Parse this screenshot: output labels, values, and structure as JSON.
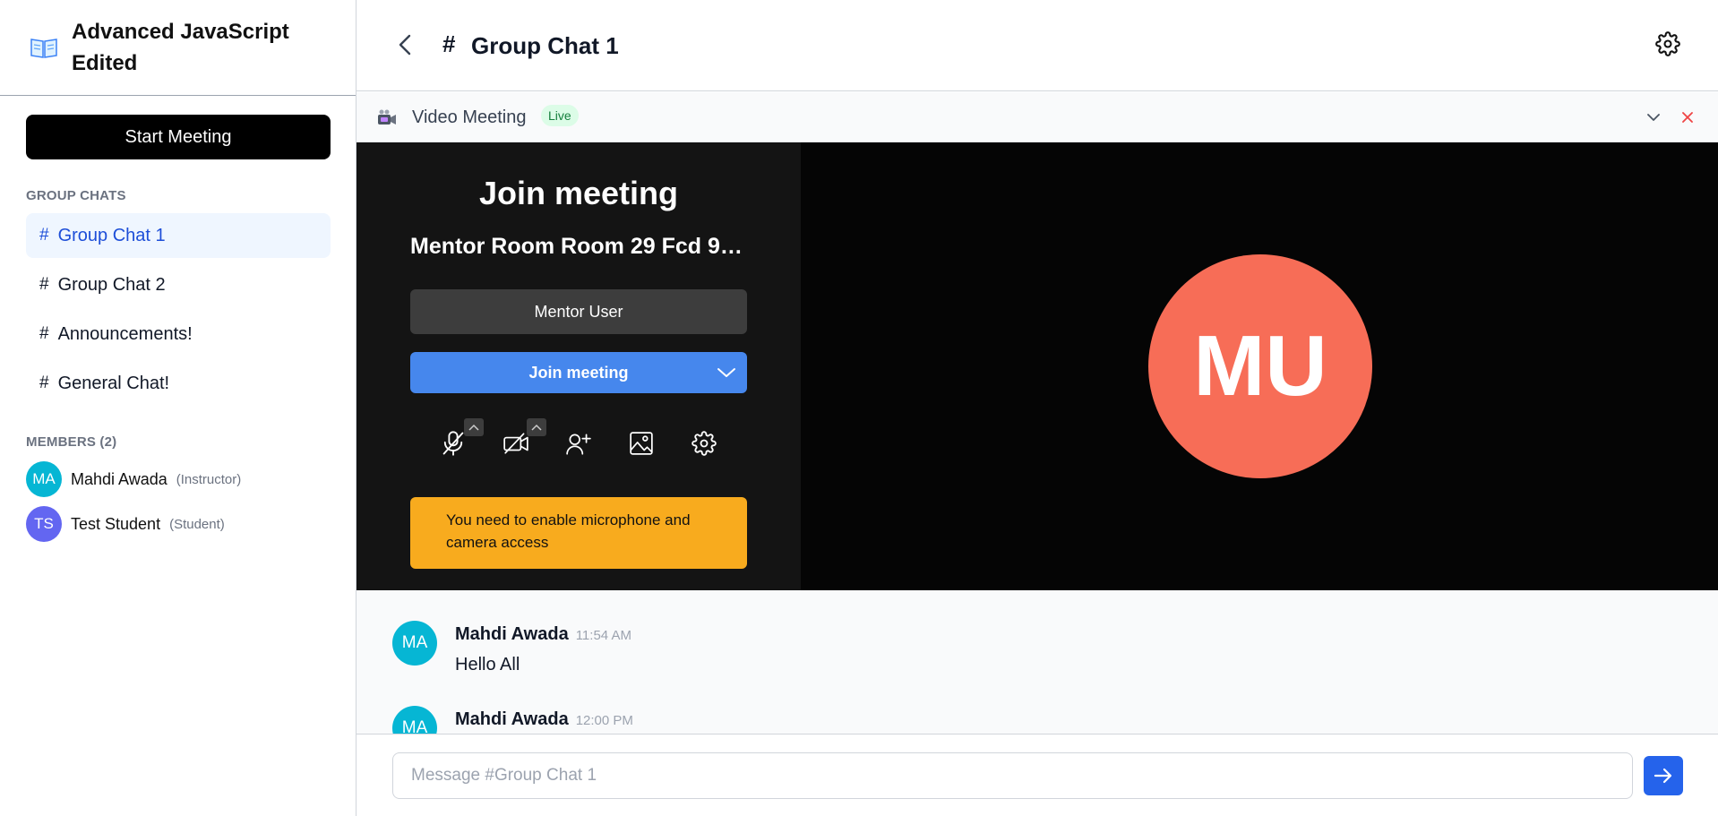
{
  "sidebar": {
    "course_title": "Advanced JavaScript Edited",
    "start_meeting_label": "Start Meeting",
    "group_chats_label": "GROUP CHATS",
    "chats": [
      {
        "label": "Group Chat 1",
        "active": true
      },
      {
        "label": "Group Chat 2",
        "active": false
      },
      {
        "label": "Announcements!",
        "active": false
      },
      {
        "label": "General Chat!",
        "active": false
      }
    ],
    "members_label": "MEMBERS (2)",
    "members": [
      {
        "initials": "MA",
        "name": "Mahdi Awada",
        "role": "(Instructor)",
        "color": "#06b6d4"
      },
      {
        "initials": "TS",
        "name": "Test Student",
        "role": "(Student)",
        "color": "#6366f1"
      }
    ]
  },
  "header": {
    "hash": "#",
    "title": "Group Chat 1"
  },
  "video_meeting": {
    "title": "Video Meeting",
    "badge": "Live",
    "join_title": "Join meeting",
    "room_name": "Mentor Room Room 29 Fcd 9…",
    "user_name": "Mentor User",
    "join_button": "Join meeting",
    "warning": "You need to enable microphone and camera access",
    "participant_initials": "MU",
    "participant_color": "#f76d57"
  },
  "messages": [
    {
      "initials": "MA",
      "author": "Mahdi Awada",
      "time": "11:54 AM",
      "text": "Hello All",
      "color": "#06b6d4"
    },
    {
      "initials": "MA",
      "author": "Mahdi Awada",
      "time": "12:00 PM",
      "text": "",
      "color": "#06b6d4"
    }
  ],
  "composer": {
    "placeholder": "Message #Group Chat 1"
  },
  "colors": {
    "accent": "#2563eb",
    "active_chat_bg": "#eff6ff",
    "warning": "#f8ab1e"
  }
}
